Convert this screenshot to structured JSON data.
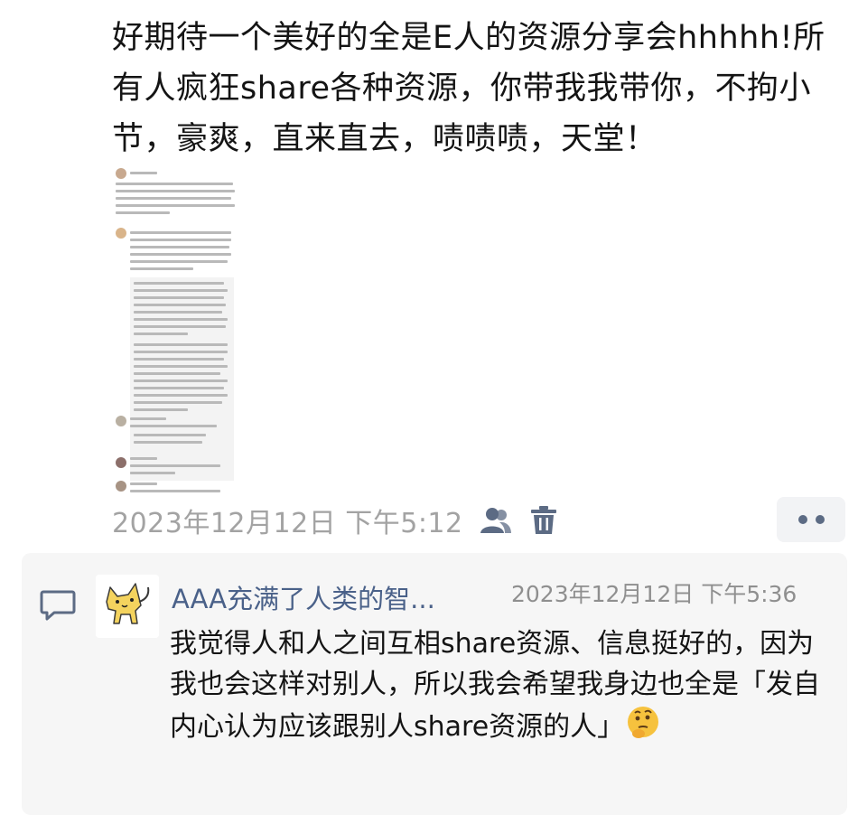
{
  "post": {
    "text": "好期待一个美好的全是E人的资源分享会hhhhh!所有人疯狂share各种资源，你带我我带你，不拘小节，豪爽，直来直去，啧啧啧，天堂！",
    "timestamp": "2023年12月12日 下午5:12"
  },
  "icons": {
    "visibility": "people-icon",
    "delete": "trash-icon",
    "more": "more-dots-icon",
    "comment": "comment-bubble-icon",
    "avatar": "cat-avatar",
    "emoji": "thinking-face-emoji"
  },
  "comment": {
    "author": "AAA充满了人类的智...",
    "timestamp": "2023年12月12日 下午5:36",
    "text": "我觉得人和人之间互相share资源、信息挺好的，因为我也会这样对别人，所以我会希望我身边也全是「发自内心认为应该跟别人share资源的人」"
  },
  "colors": {
    "name_link": "#4a6189",
    "timestamp": "#a3a3a3",
    "more_dots": "#5c6b84",
    "comment_bg": "#f6f6f6"
  }
}
